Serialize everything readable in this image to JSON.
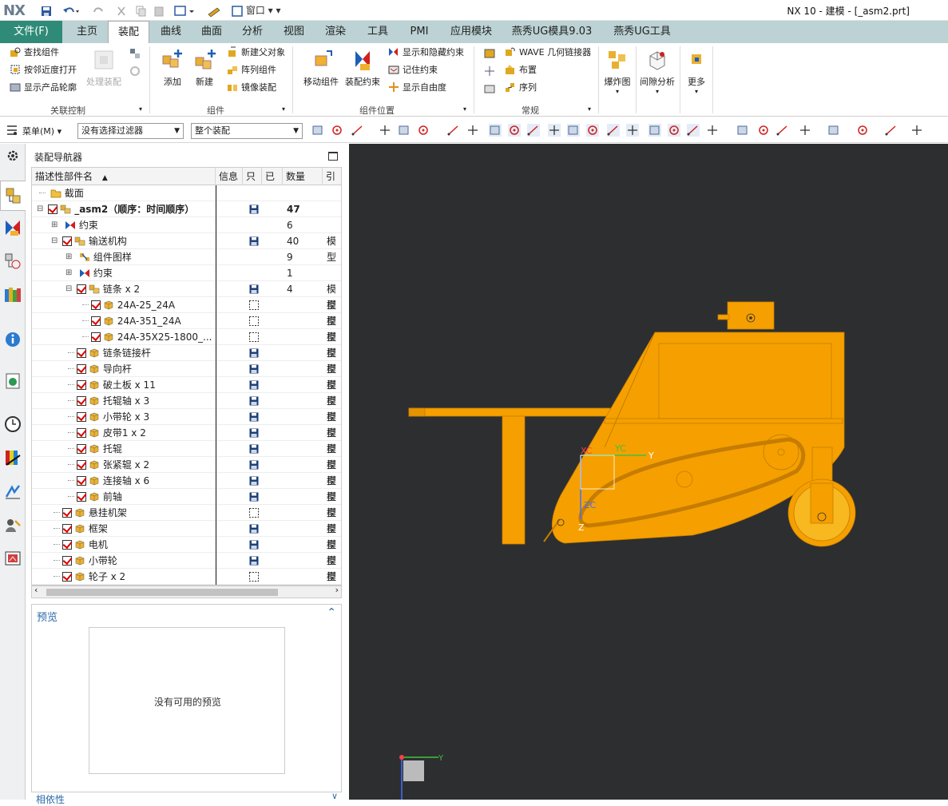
{
  "app": {
    "logo": "NX",
    "window_title": "NX 10 - 建模 - [_asm2.prt]",
    "window_menu": "窗口"
  },
  "ribbon_tabs": [
    "文件(F)",
    "主页",
    "装配",
    "曲线",
    "曲面",
    "分析",
    "视图",
    "渲染",
    "工具",
    "PMI",
    "应用模块",
    "燕秀UG模具9.03",
    "燕秀UG工具"
  ],
  "active_tab": "装配",
  "ribbon": {
    "assoc": {
      "find": "查找组件",
      "open_nearby": "按邻近度打开",
      "show_outline": "显示产品轮廓",
      "wave_disabled": "处理装配",
      "label": "关联控制"
    },
    "components": {
      "add": "添加",
      "new": "新建",
      "new_parent": "新建父对象",
      "array": "阵列组件",
      "mirror": "镜像装配",
      "label": "组件"
    },
    "position": {
      "move": "移动组件",
      "constraint": "装配约束",
      "show_hide": "显示和隐藏约束",
      "remember": "记住约束",
      "show_dof": "显示自由度",
      "label": "组件位置"
    },
    "general": {
      "wave": "WAVE 几何链接器",
      "layout": "布置",
      "sequence": "序列",
      "label": "常规"
    },
    "explode": "爆炸图",
    "clearance": "间隙分析",
    "more": "更多"
  },
  "toolbar": {
    "menu": "菜单(M)",
    "filter": "没有选择过滤器",
    "scope": "整个装配"
  },
  "navigator": {
    "title": "装配导航器",
    "columns": [
      "描述性部件名",
      "信息",
      "只",
      "已",
      "数量",
      "引"
    ],
    "rows": [
      {
        "indent": 0,
        "check": false,
        "icon": "folder",
        "name": "截面",
        "qty": "",
        "ref": "",
        "save": "none"
      },
      {
        "indent": 0,
        "check": true,
        "icon": "asm",
        "name": "_asm2（顺序：时间顺序）",
        "qty": "47",
        "ref": "",
        "save": "full",
        "bold": true,
        "toggle": "-"
      },
      {
        "indent": 1,
        "check": false,
        "icon": "constraint",
        "name": "约束",
        "qty": "6",
        "ref": "",
        "save": "none",
        "toggle": "+"
      },
      {
        "indent": 1,
        "check": true,
        "icon": "asm",
        "name": "输送机构",
        "qty": "40",
        "ref": "模型",
        "save": "full",
        "toggle": "-"
      },
      {
        "indent": 2,
        "check": false,
        "icon": "pattern",
        "name": "组件图样",
        "qty": "9",
        "ref": "",
        "save": "none",
        "toggle": "+"
      },
      {
        "indent": 2,
        "check": false,
        "icon": "constraint",
        "name": "约束",
        "qty": "1",
        "ref": "",
        "save": "none",
        "toggle": "+"
      },
      {
        "indent": 2,
        "check": true,
        "icon": "asm",
        "name": "链条 x 2",
        "qty": "4",
        "ref": "模型",
        "save": "full",
        "toggle": "-"
      },
      {
        "indent": 3,
        "check": true,
        "icon": "part",
        "name": "24A-25_24A",
        "qty": "",
        "ref": "模型",
        "save": "dash"
      },
      {
        "indent": 3,
        "check": true,
        "icon": "part",
        "name": "24A-351_24A",
        "qty": "",
        "ref": "模型",
        "save": "dash"
      },
      {
        "indent": 3,
        "check": true,
        "icon": "part",
        "name": "24A-35X25-1800_...",
        "qty": "",
        "ref": "模型",
        "save": "dash"
      },
      {
        "indent": 2,
        "check": true,
        "icon": "part",
        "name": "链条链接杆",
        "qty": "",
        "ref": "模型",
        "save": "full"
      },
      {
        "indent": 2,
        "check": true,
        "icon": "part",
        "name": "导向杆",
        "qty": "",
        "ref": "模型",
        "save": "full"
      },
      {
        "indent": 2,
        "check": true,
        "icon": "part",
        "name": "破土板 x 11",
        "qty": "",
        "ref": "模型",
        "save": "full"
      },
      {
        "indent": 2,
        "check": true,
        "icon": "part",
        "name": "托辊轴 x 3",
        "qty": "",
        "ref": "模型",
        "save": "full"
      },
      {
        "indent": 2,
        "check": true,
        "icon": "part",
        "name": "小带轮 x 3",
        "qty": "",
        "ref": "模型",
        "save": "full"
      },
      {
        "indent": 2,
        "check": true,
        "icon": "part",
        "name": "皮带1 x 2",
        "qty": "",
        "ref": "模型",
        "save": "full"
      },
      {
        "indent": 2,
        "check": true,
        "icon": "part",
        "name": "托辊",
        "qty": "",
        "ref": "模型",
        "save": "full"
      },
      {
        "indent": 2,
        "check": true,
        "icon": "part",
        "name": "张紧辊 x 2",
        "qty": "",
        "ref": "模型",
        "save": "full"
      },
      {
        "indent": 2,
        "check": true,
        "icon": "part",
        "name": "连接轴 x 6",
        "qty": "",
        "ref": "模型",
        "save": "full"
      },
      {
        "indent": 2,
        "check": true,
        "icon": "part",
        "name": "前轴",
        "qty": "",
        "ref": "模型",
        "save": "full"
      },
      {
        "indent": 1,
        "check": true,
        "icon": "part",
        "name": "悬挂机架",
        "qty": "",
        "ref": "模型",
        "save": "dash"
      },
      {
        "indent": 1,
        "check": true,
        "icon": "part",
        "name": "框架",
        "qty": "",
        "ref": "模型",
        "save": "full"
      },
      {
        "indent": 1,
        "check": true,
        "icon": "part",
        "name": "电机",
        "qty": "",
        "ref": "模型",
        "save": "full"
      },
      {
        "indent": 1,
        "check": true,
        "icon": "part",
        "name": "小带轮",
        "qty": "",
        "ref": "模型",
        "save": "full"
      },
      {
        "indent": 1,
        "check": true,
        "icon": "part",
        "name": "轮子 x 2",
        "qty": "",
        "ref": "模型",
        "save": "dash"
      }
    ]
  },
  "preview": {
    "title": "预览",
    "empty_text": "没有可用的预览"
  },
  "dependencies": {
    "title": "相依性"
  },
  "viewport": {
    "axes": {
      "xc": "XC",
      "yc": "YC",
      "zc": "ZC",
      "y": "Y",
      "z": "Z"
    },
    "model_color": "#f5a000"
  }
}
